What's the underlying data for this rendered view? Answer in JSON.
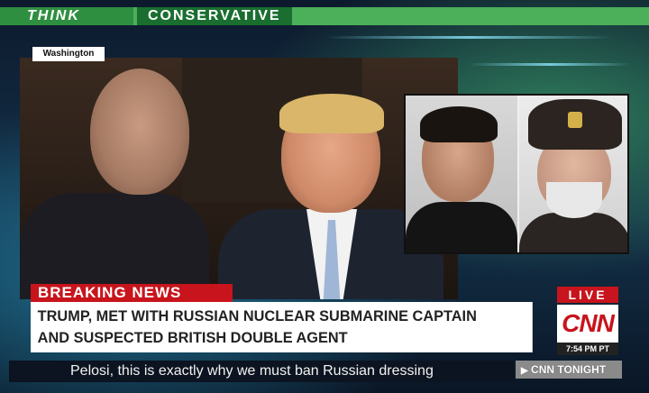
{
  "banner": {
    "left": "THINK",
    "right": "CONSERVATIVE"
  },
  "photo": {
    "dateline": "Washington"
  },
  "breaking_label": "BREAKING NEWS",
  "headline": {
    "line1": "TRUMP,  MET WITH RUSSIAN NUCLEAR SUBMARINE CAPTAIN",
    "line2": "AND SUSPECTED BRITISH DOUBLE AGENT"
  },
  "bug": {
    "live": "LIVE",
    "logo": "CNN",
    "time": "7:54 PM PT"
  },
  "ticker": "Pelosi, this is exactly why we must ban Russian dressing",
  "show": {
    "name": "CNN TONIGHT",
    "icon": "triangle-right-icon"
  },
  "colors": {
    "red": "#c8141c",
    "green": "#4caf5a"
  }
}
